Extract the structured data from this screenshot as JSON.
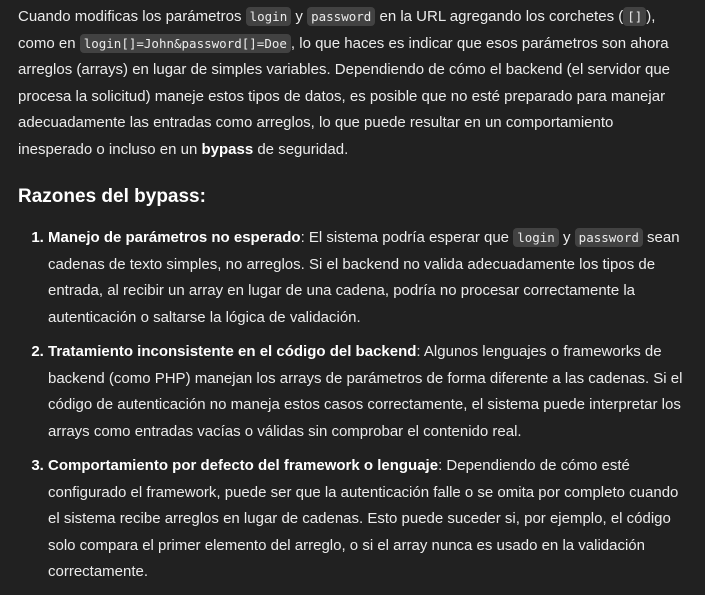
{
  "intro": {
    "t1": "Cuando modificas los parámetros ",
    "code1": "login",
    "t2": " y ",
    "code2": "password",
    "t3": " en la URL agregando los corchetes (",
    "code3": "[]",
    "t4": "), como en ",
    "code4": "login[]=John&password[]=Doe",
    "t5": ", lo que haces es indicar que esos parámetros son ahora arreglos (arrays) en lugar de simples variables. Dependiendo de cómo el backend (el servidor que procesa la solicitud) maneje estos tipos de datos, es posible que no esté preparado para manejar adecuadamente las entradas como arreglos, lo que puede resultar en un comportamiento inesperado o incluso en un ",
    "bold1": "bypass",
    "t6": " de seguridad."
  },
  "heading": "Razones del bypass:",
  "reasons": [
    {
      "title": "Manejo de parámetros no esperado",
      "t1": ": El sistema podría esperar que ",
      "code1": "login",
      "t2": " y ",
      "code2": "password",
      "t3": " sean cadenas de texto simples, no arreglos. Si el backend no valida adecuadamente los tipos de entrada, al recibir un array en lugar de una cadena, podría no procesar correctamente la autenticación o saltarse la lógica de validación."
    },
    {
      "title": "Tratamiento inconsistente en el código del backend",
      "t1": ": Algunos lenguajes o frameworks de backend (como PHP) manejan los arrays de parámetros de forma diferente a las cadenas. Si el código de autenticación no maneja estos casos correctamente, el sistema puede interpretar los arrays como entradas vacías o válidas sin comprobar el contenido real."
    },
    {
      "title": "Comportamiento por defecto del framework o lenguaje",
      "t1": ": Dependiendo de cómo esté configurado el framework, puede ser que la autenticación falle o se omita por completo cuando el sistema recibe arreglos en lugar de cadenas. Esto puede suceder si, por ejemplo, el código solo compara el primer elemento del arreglo, o si el array nunca es usado en la validación correctamente."
    }
  ]
}
